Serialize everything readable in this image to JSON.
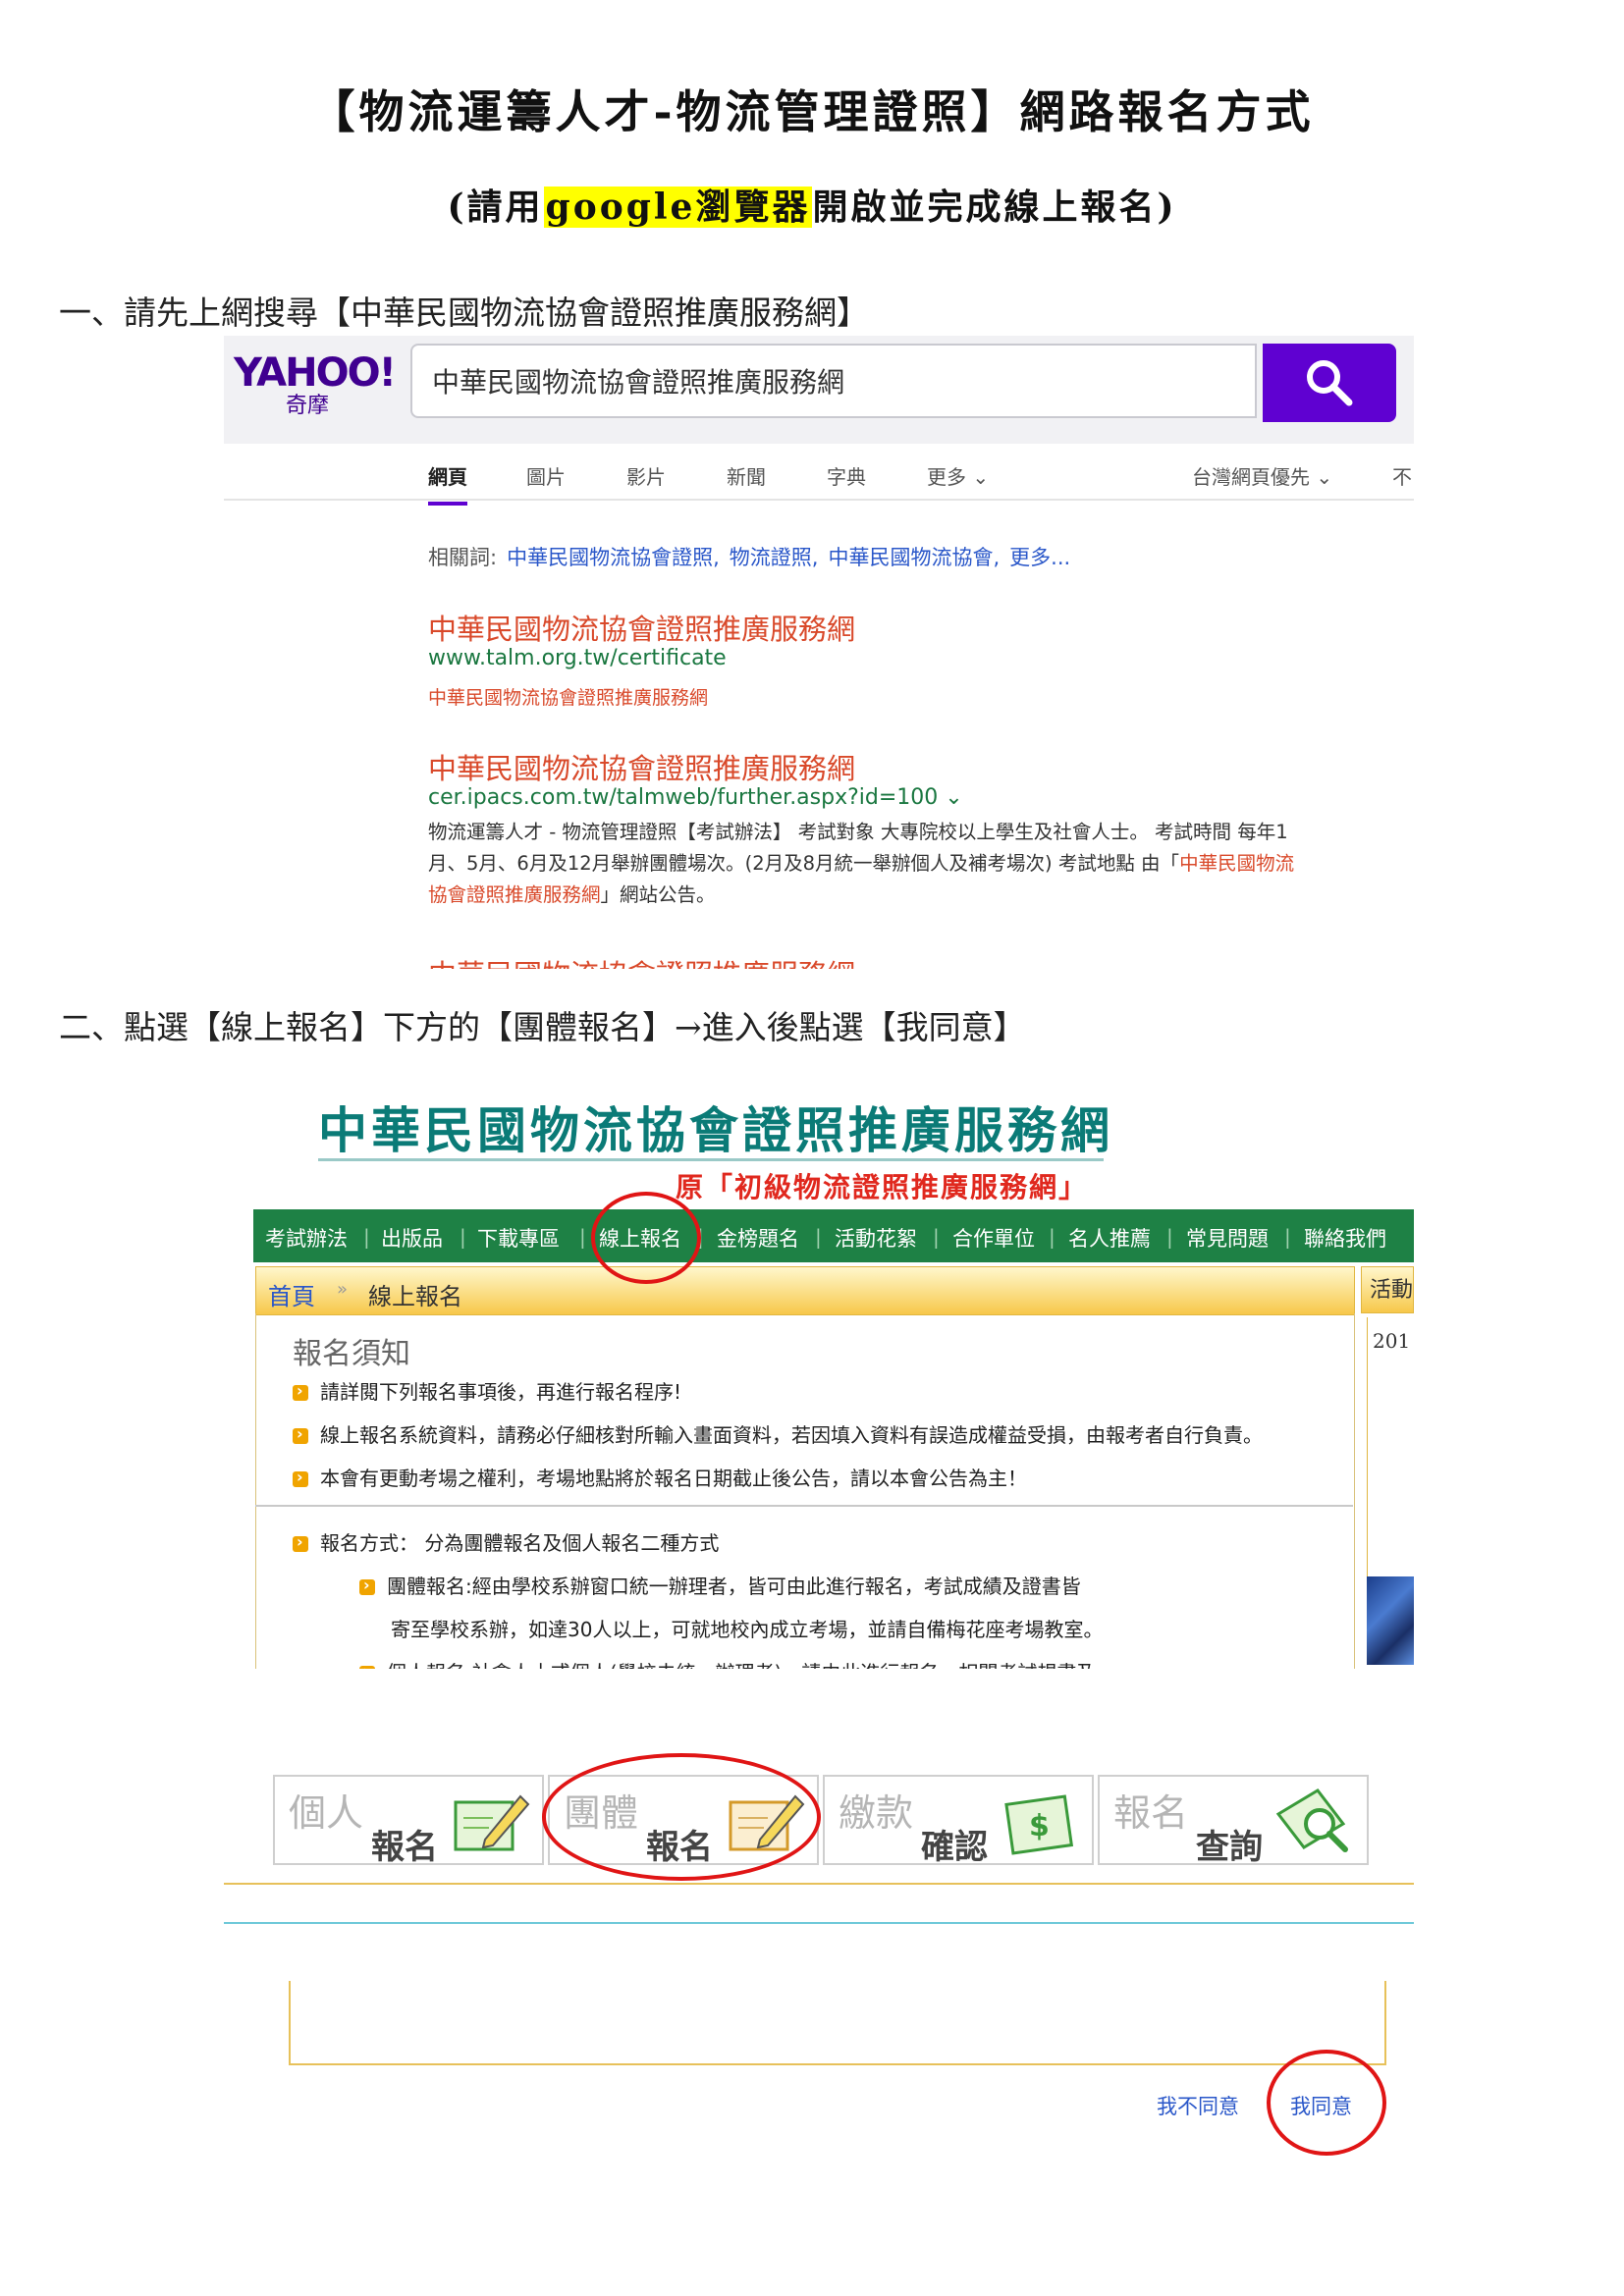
{
  "doc": {
    "title": "【物流運籌人才-物流管理證照】網路報名方式",
    "subtitle_pre": "(請用",
    "subtitle_highlight": "google瀏覽器",
    "subtitle_post": "開啟並完成線上報名)",
    "step1": "一、請先上網搜尋【中華民國物流協會證照推廣服務網】",
    "step2": "二、點選【線上報名】下方的【團體報名】→進入後點選【我同意】"
  },
  "yahoo": {
    "logo_word": "YAHOO!",
    "logo_cn": "奇摩",
    "search_value": "中華民國物流協會證照推廣服務網",
    "search_icon": "search-icon",
    "tabs": [
      "網頁",
      "圖片",
      "影片",
      "新聞",
      "字典",
      "更多 ⌄",
      "台灣網頁優先 ⌄",
      "不"
    ],
    "related_label": "相關詞:",
    "related_links": [
      "中華民國物流協會證照,",
      "物流證照,",
      "中華民國物流協會,",
      "更多..."
    ],
    "results": [
      {
        "title": "中華民國物流協會證照推廣服務網",
        "url": "www.talm.org.tw/certificate",
        "desc": "中華民國物流協會證照推廣服務網"
      },
      {
        "title": "中華民國物流協會證照推廣服務網",
        "url": "cer.ipacs.com.tw/talmweb/further.aspx?id=100 ⌄",
        "snippet_1": "物流運籌人才 - 物流管理證照【考試辦法】 考試對象 大專院校以上學生及社會人士。 考試時間 每年1",
        "snippet_2_pre": "月、5月、6月及12月舉辦團體場次。(2月及8月統一舉辦個人及補考場次) 考試地點 由「",
        "snippet_2_red": "中華民國物流",
        "snippet_3_red": "協會證照推廣服務網",
        "snippet_3_post": "」網站公告。"
      },
      {
        "title": "中華民國物流協會證照推廣服務網"
      }
    ]
  },
  "site": {
    "title": "中華民國物流協會證照推廣服務網",
    "subtitle": "原「初級物流證照推廣服務網」",
    "nav": [
      "考試辦法",
      "出版品",
      "下載專區",
      "線上報名",
      "金榜題名",
      "活動花絮",
      "合作單位",
      "名人推薦",
      "常見問題",
      "聯絡我們"
    ],
    "breadcrumb_home": "首頁",
    "breadcrumb_current": "線上報名",
    "side_head": "活動",
    "side_year": "201",
    "notice_title": "報名須知",
    "notices": [
      "請詳閱下列報名事項後，再進行報名程序!",
      "線上報名系統資料，請務必仔細核對所輸入畫面資料，若因填入資料有誤造成權益受損，由報考者自行負責。",
      "本會有更動考場之權利，考場地點將於報名日期截止後公告，請以本會公告為主！"
    ],
    "method": "報名方式： 分為團體報名及個人報名二種方式",
    "group_1": "團體報名:經由學校系辦窗口統一辦理者，皆可由此進行報名，考試成績及證書皆",
    "group_2": "寄至學校系辦，如達30人以上，可就地校內成立考場，並請自備梅花座考場教室。",
    "individual": "個人報名:社會人士或個人(學校未統一辦理者)，請由此進行報名，相關考試規書及"
  },
  "agree": {
    "buttons": [
      {
        "a": "個人",
        "b": "報名",
        "icon": "pencil-form-icon"
      },
      {
        "a": "團體",
        "b": "報名",
        "icon": "pencil-form-icon"
      },
      {
        "a": "繳款",
        "b": "確認",
        "icon": "money-icon"
      },
      {
        "a": "報名",
        "b": "查詢",
        "icon": "magnifier-form-icon"
      }
    ],
    "disagree": "我不同意",
    "agree": "我同意"
  },
  "colors": {
    "annotation": "#e01515",
    "yahoo_purple": "#5f01d1",
    "nav_green": "#1e8145",
    "site_teal": "#0b7b77"
  }
}
